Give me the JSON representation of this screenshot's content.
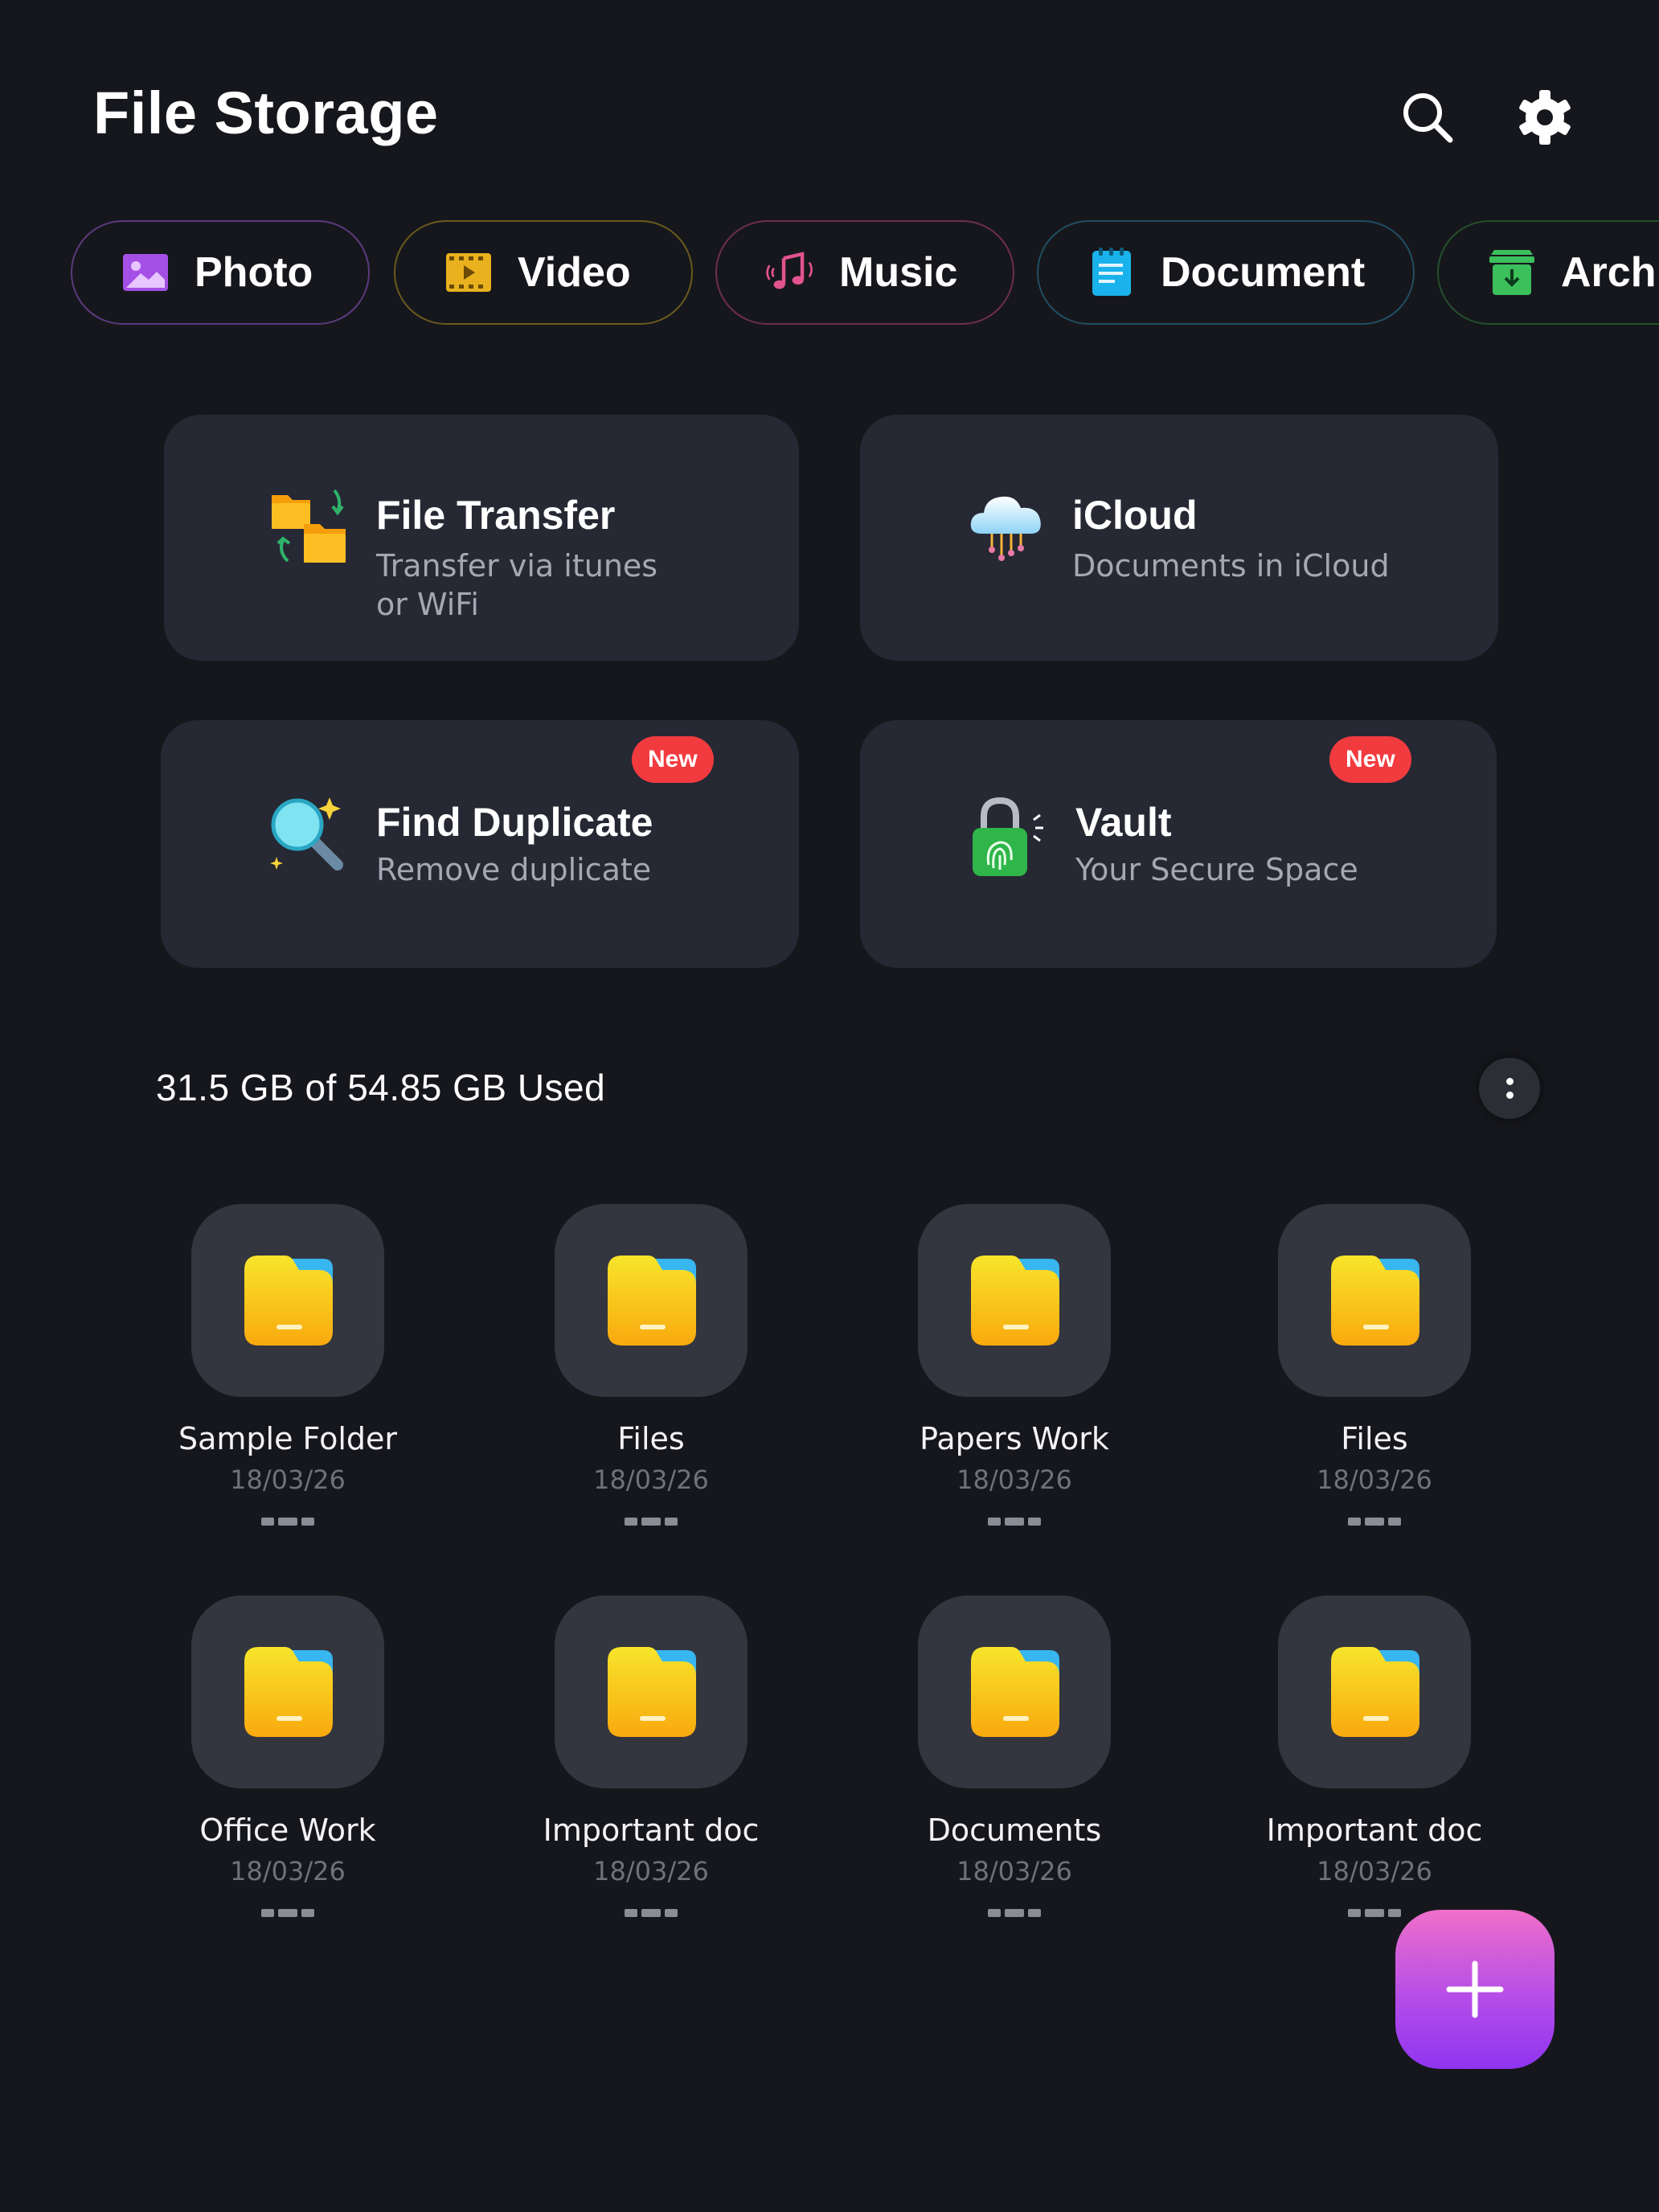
{
  "header": {
    "title": "File Storage",
    "search_icon": "search-icon",
    "settings_icon": "gear-icon"
  },
  "categories": [
    {
      "label": "Photo",
      "icon": "image-icon",
      "color": "#a44fe6"
    },
    {
      "label": "Video",
      "icon": "film-icon",
      "color": "#e9b11e"
    },
    {
      "label": "Music",
      "icon": "music-icon",
      "color": "#e2538f"
    },
    {
      "label": "Document",
      "icon": "document-icon",
      "color": "#1ab2ec"
    },
    {
      "label": "Arch",
      "icon": "archive-icon",
      "color": "#3bc05c"
    }
  ],
  "cards": [
    {
      "title": "File Transfer",
      "subtitle_line1": "Transfer via itunes",
      "subtitle_line2": "or WiFi",
      "icon": "folder-transfer-icon"
    },
    {
      "title": "iCloud",
      "subtitle_line1": "Documents in iCloud",
      "icon": "cloud-icon"
    },
    {
      "title": "Find Duplicate",
      "subtitle_line1": "Remove duplicate",
      "badge": "New",
      "icon": "magnifier-icon"
    },
    {
      "title": "Vault",
      "subtitle_line1": "Your Secure Space",
      "badge": "New",
      "icon": "fingerprint-lock-icon"
    }
  ],
  "storage": {
    "text": "31.5 GB  of  54.85 GB  Used",
    "used_gb": 31.5,
    "total_gb": 54.85
  },
  "folders": [
    {
      "name": "Sample Folder",
      "date": "18/03/26"
    },
    {
      "name": "Files",
      "date": "18/03/26"
    },
    {
      "name": "Papers Work",
      "date": "18/03/26"
    },
    {
      "name": "Files",
      "date": "18/03/26"
    },
    {
      "name": "Office Work",
      "date": "18/03/26"
    },
    {
      "name": "Important doc",
      "date": "18/03/26"
    },
    {
      "name": "Documents",
      "date": "18/03/26"
    },
    {
      "name": "Important doc",
      "date": "18/03/26"
    }
  ],
  "fab": {
    "icon": "plus-icon"
  }
}
